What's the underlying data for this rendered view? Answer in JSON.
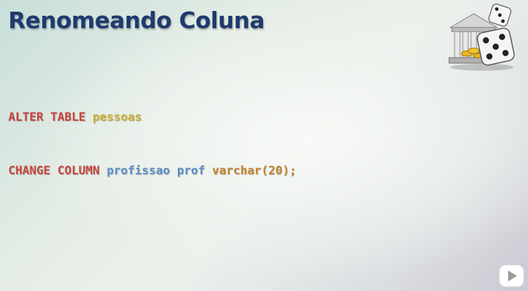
{
  "slide": {
    "title": "Renomeando Coluna"
  },
  "code": {
    "line1": {
      "keyword": "ALTER TABLE",
      "table": "pessoas"
    },
    "line2": {
      "keyword": "CHANGE COLUMN",
      "old_column": "profissao",
      "new_column": "prof",
      "type": "varchar(20);"
    }
  },
  "colors": {
    "title": "#1f3a6e",
    "keyword": "#c8463e",
    "table": "#cbb133",
    "column": "#5b8fc7",
    "type": "#c4822f"
  },
  "icons": {
    "logo": "bank-dice-logo-icon",
    "play": "play-button-icon"
  }
}
